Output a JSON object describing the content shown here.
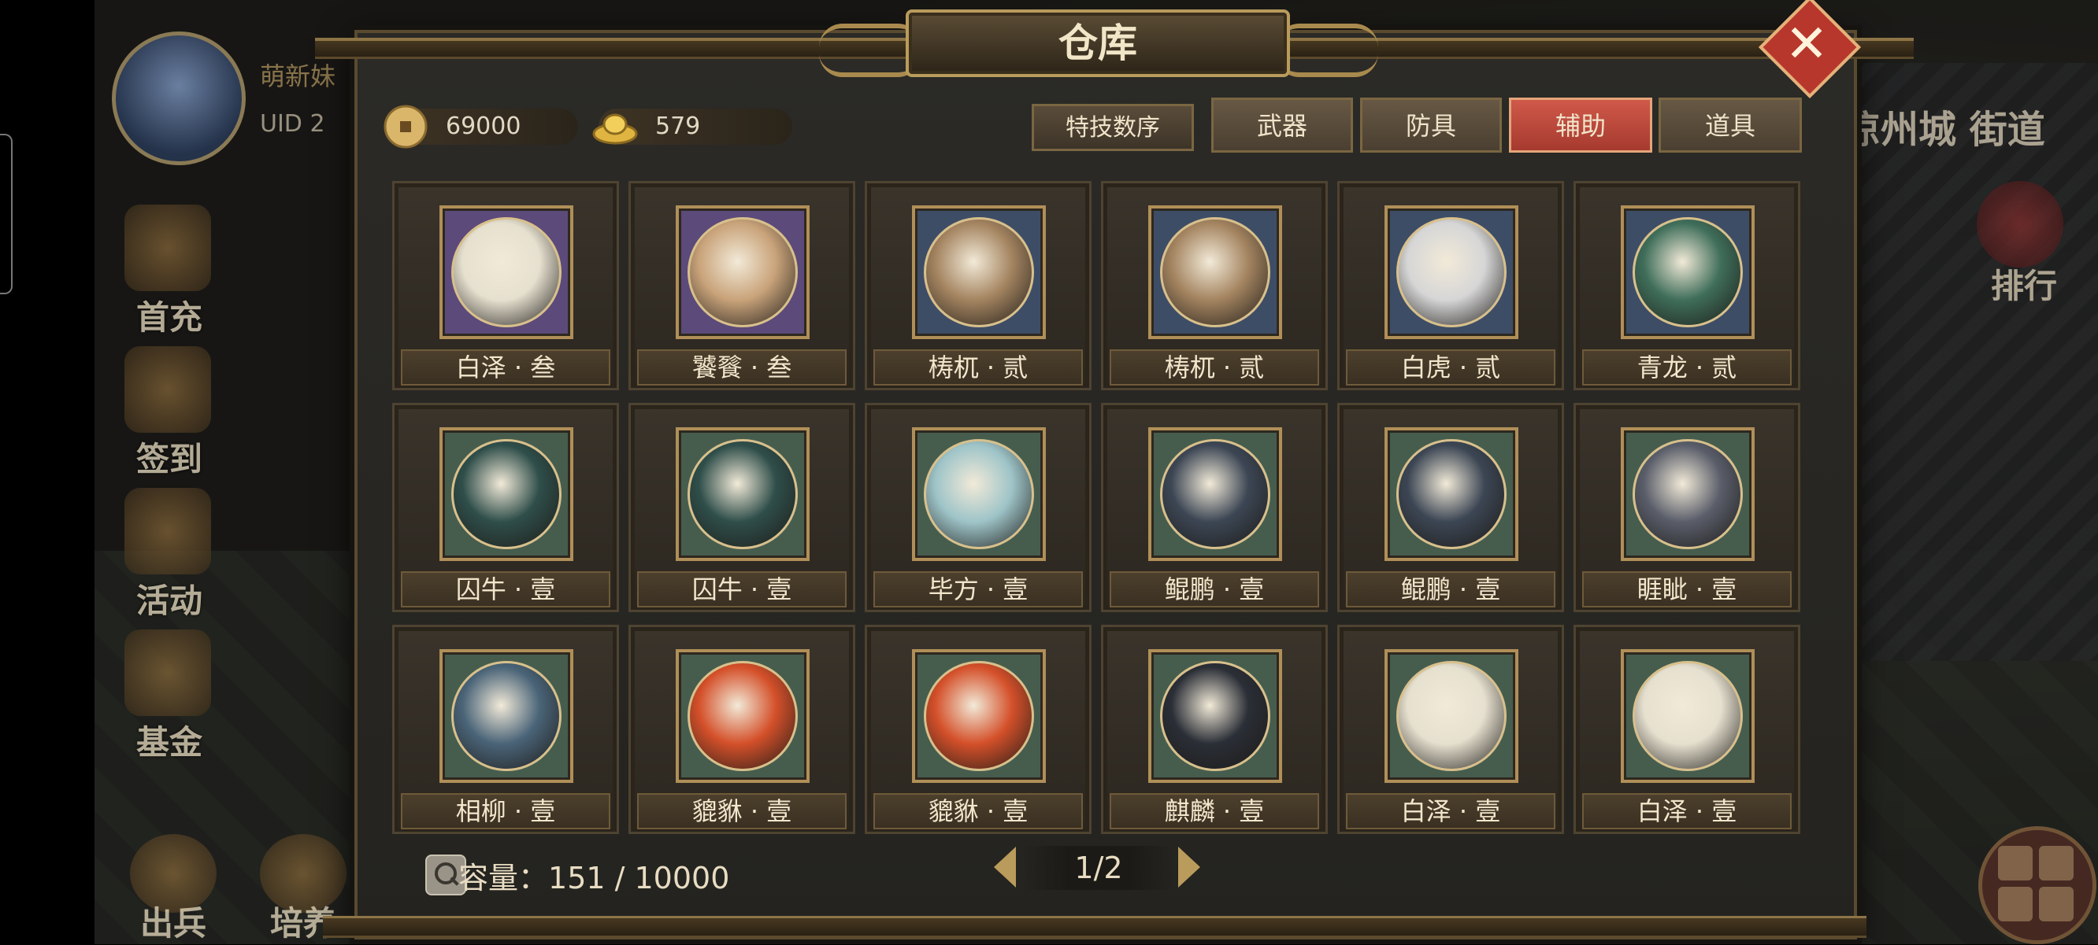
{
  "background": {
    "player": {
      "name": "萌新妹",
      "uid": "UID 2"
    },
    "side_menu": [
      "首充",
      "签到",
      "活动",
      "基金"
    ],
    "bottom_menu": [
      "出兵",
      "培养"
    ],
    "location": "凉州城 街道",
    "rank_label": "排行",
    "icons": [
      "player-avatar",
      "first-charge-icon",
      "sign-in-icon",
      "activity-icon",
      "fund-icon",
      "dispatch-icon",
      "cultivate-icon",
      "rank-icon",
      "grid-menu-icon"
    ]
  },
  "panel": {
    "title": "仓库",
    "close_icon": "✕",
    "currencies": [
      {
        "name": "copper-coin",
        "value": "69000"
      },
      {
        "name": "gold-ingot",
        "value": "579"
      }
    ],
    "sort_button": "特技数序",
    "tabs": [
      {
        "label": "武器",
        "active": false
      },
      {
        "label": "防具",
        "active": false
      },
      {
        "label": "辅助",
        "active": true
      },
      {
        "label": "道具",
        "active": false
      }
    ],
    "items": [
      {
        "name": "白泽 · 叁",
        "bg": "purple",
        "color": "#e6e0cf"
      },
      {
        "name": "饕餮 · 叁",
        "bg": "purple",
        "color": "#c9a37a"
      },
      {
        "name": "梼杌 · 贰",
        "bg": "blue",
        "color": "#a48460"
      },
      {
        "name": "梼杌 · 贰",
        "bg": "blue",
        "color": "#a48460"
      },
      {
        "name": "白虎 · 贰",
        "bg": "blue",
        "color": "#d6d6d6"
      },
      {
        "name": "青龙 · 贰",
        "bg": "blue",
        "color": "#3f6e5a"
      },
      {
        "name": "囚牛 · 壹",
        "bg": "green",
        "color": "#2f4e4a"
      },
      {
        "name": "囚牛 · 壹",
        "bg": "green",
        "color": "#2f4e4a"
      },
      {
        "name": "毕方 · 壹",
        "bg": "green",
        "color": "#9ec4c8"
      },
      {
        "name": "鲲鹏 · 壹",
        "bg": "green",
        "color": "#3c4654"
      },
      {
        "name": "鲲鹏 · 壹",
        "bg": "green",
        "color": "#3c4654"
      },
      {
        "name": "睚眦 · 壹",
        "bg": "green",
        "color": "#5a5e6a"
      },
      {
        "name": "相柳 · 壹",
        "bg": "green",
        "color": "#4a6478"
      },
      {
        "name": "貔貅 · 壹",
        "bg": "green",
        "color": "#d4502a"
      },
      {
        "name": "貔貅 · 壹",
        "bg": "green",
        "color": "#d4502a"
      },
      {
        "name": "麒麟 · 壹",
        "bg": "green",
        "color": "#2a2e36"
      },
      {
        "name": "白泽 · 壹",
        "bg": "green",
        "color": "#e6e0cf"
      },
      {
        "name": "白泽 · 壹",
        "bg": "green",
        "color": "#e6e0cf"
      }
    ],
    "capacity_label": "容量：",
    "capacity_value": "151 / 10000",
    "page": "1/2"
  }
}
